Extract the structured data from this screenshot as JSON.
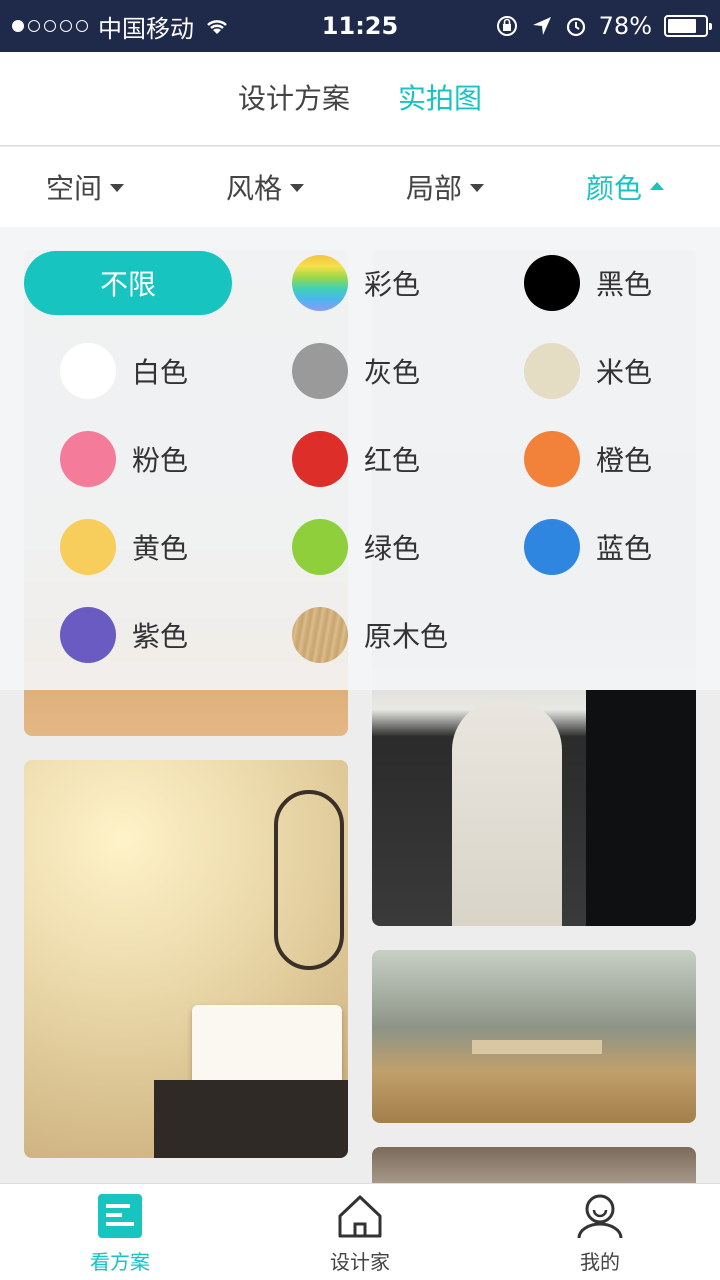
{
  "status_bar": {
    "carrier": "中国移动",
    "time": "11:25",
    "battery": "78%",
    "battery_level": 0.78
  },
  "top_tabs": [
    {
      "label": "设计方案",
      "active": false
    },
    {
      "label": "实拍图",
      "active": true
    }
  ],
  "filters": [
    {
      "label": "空间",
      "active": false
    },
    {
      "label": "风格",
      "active": false
    },
    {
      "label": "局部",
      "active": false
    },
    {
      "label": "颜色",
      "active": true
    }
  ],
  "color_dropdown": {
    "any_label": "不限",
    "options": [
      {
        "label": "彩色",
        "color": "rainbow"
      },
      {
        "label": "黑色",
        "color": "#000000"
      },
      {
        "label": "白色",
        "color": "#ffffff"
      },
      {
        "label": "灰色",
        "color": "#9a9a9a"
      },
      {
        "label": "米色",
        "color": "#e4dcc3"
      },
      {
        "label": "粉色",
        "color": "#f47c9a"
      },
      {
        "label": "红色",
        "color": "#dd2e2a"
      },
      {
        "label": "橙色",
        "color": "#f2823a"
      },
      {
        "label": "黄色",
        "color": "#f7cd5b"
      },
      {
        "label": "绿色",
        "color": "#8fcf3c"
      },
      {
        "label": "蓝色",
        "color": "#2e86e0"
      },
      {
        "label": "紫色",
        "color": "#6a5bc2"
      },
      {
        "label": "原木色",
        "color": "wood"
      }
    ]
  },
  "bottom_nav": [
    {
      "label": "看方案",
      "icon": "document-icon",
      "active": true
    },
    {
      "label": "设计家",
      "icon": "house-icon",
      "active": false
    },
    {
      "label": "我的",
      "icon": "user-icon",
      "active": false
    }
  ],
  "colors": {
    "accent": "#17c4c0",
    "status_bar_bg": "#1f2a4a"
  }
}
